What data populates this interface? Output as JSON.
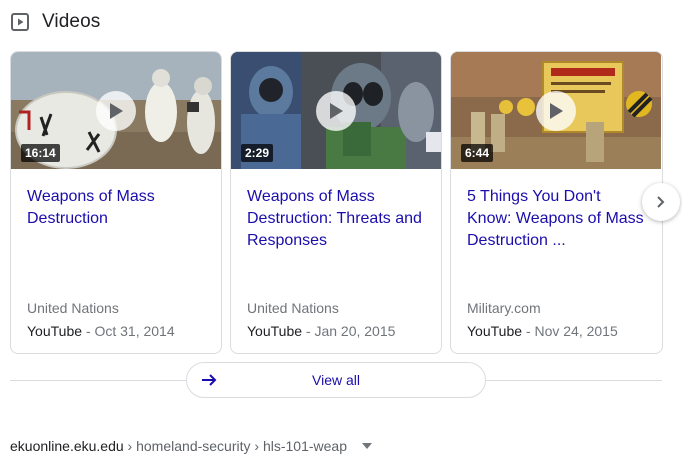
{
  "section": {
    "title": "Videos",
    "icon": "play-square-icon"
  },
  "videos": [
    {
      "title": "Weapons of Mass Destruction",
      "duration": "16:14",
      "channel": "United Nations",
      "source": "YouTube",
      "date": " - Oct 31, 2014"
    },
    {
      "title": "Weapons of Mass Destruction: Threats and Responses",
      "duration": "2:29",
      "channel": "United Nations",
      "source": "YouTube",
      "date": " - Jan 20, 2015"
    },
    {
      "title": "5 Things You Don't Know: Weapons of Mass Destruction ...",
      "duration": "6:44",
      "channel": "Military.com",
      "source": "YouTube",
      "date": " - Nov 24, 2015"
    }
  ],
  "view_all": {
    "label": "View all"
  },
  "result": {
    "domain": "ekuonline.eku.edu",
    "path1": "homeland-security",
    "path2": "hls-101-weap",
    "separator": " › "
  },
  "colors": {
    "link": "#1a0dab",
    "secondary": "#70757a",
    "border": "#dadce0"
  }
}
